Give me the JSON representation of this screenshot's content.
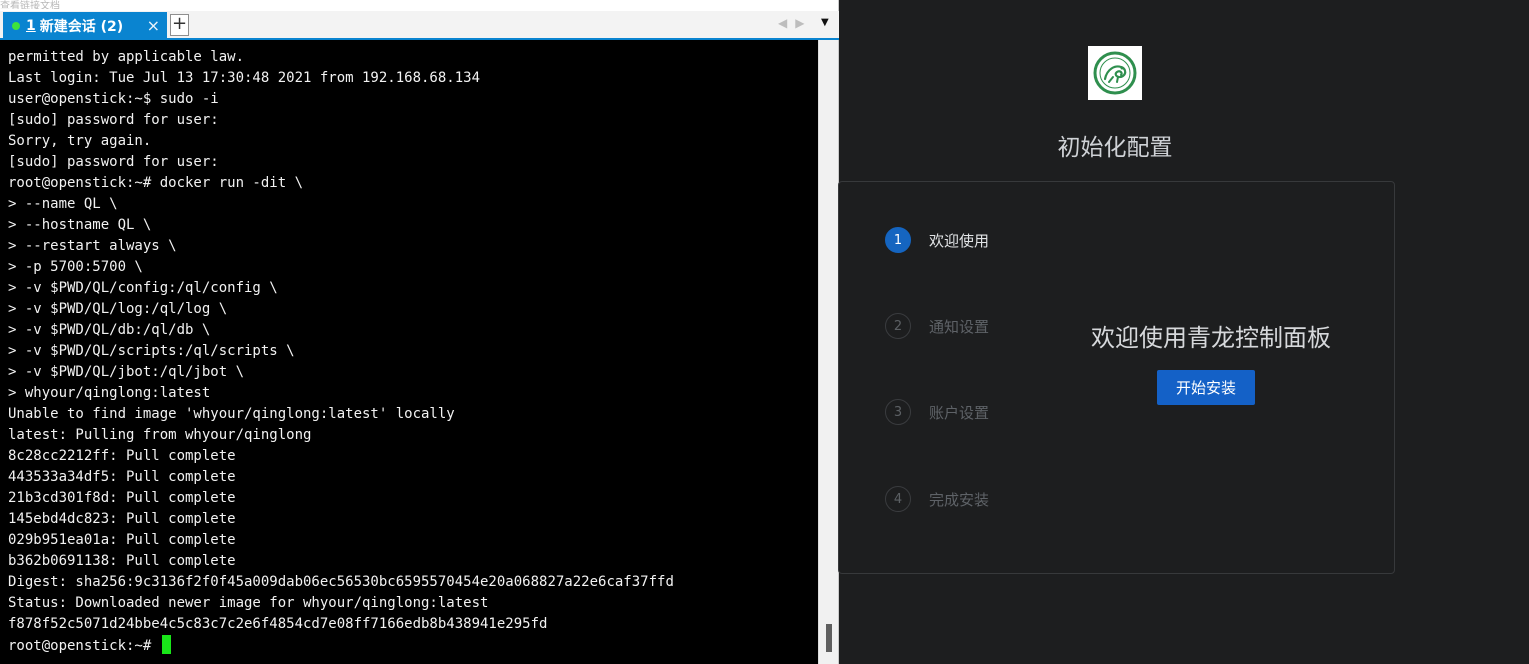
{
  "window": {
    "breadcrumb_fragment": "查看链接文档"
  },
  "terminal_tabs": {
    "active_tab": {
      "number": "1",
      "title": "新建会话 (2)",
      "close_glyph": "×"
    },
    "add_glyph": "+",
    "nav_glyphs": "◀▶",
    "menu_glyph": "▼"
  },
  "terminal": {
    "lines": [
      "permitted by applicable law.",
      "Last login: Tue Jul 13 17:30:48 2021 from 192.168.68.134",
      "user@openstick:~$ sudo -i",
      "[sudo] password for user:",
      "Sorry, try again.",
      "[sudo] password for user:",
      "root@openstick:~# docker run -dit \\",
      "> --name QL \\",
      "> --hostname QL \\",
      "> --restart always \\",
      "> -p 5700:5700 \\",
      "> -v $PWD/QL/config:/ql/config \\",
      "> -v $PWD/QL/log:/ql/log \\",
      "> -v $PWD/QL/db:/ql/db \\",
      "> -v $PWD/QL/scripts:/ql/scripts \\",
      "> -v $PWD/QL/jbot:/ql/jbot \\",
      "> whyour/qinglong:latest",
      "Unable to find image 'whyour/qinglong:latest' locally",
      "latest: Pulling from whyour/qinglong",
      "8c28cc2212ff: Pull complete",
      "443533a34df5: Pull complete",
      "21b3cd301f8d: Pull complete",
      "145ebd4dc823: Pull complete",
      "029b951ea01a: Pull complete",
      "b362b0691138: Pull complete",
      "Digest: sha256:9c3136f2f0f45a009dab06ec56530bc6595570454e20a068827a22e6caf37ffd",
      "Status: Downloaded newer image for whyour/qinglong:latest",
      "f878f52c5071d24bbe4c5c83c7c2e6f4854cd7e08ff7166edb8b438941e295fd"
    ],
    "prompt": "root@openstick:~# ",
    "cursor_color": "#19e619"
  },
  "setup": {
    "logo_icon": "qinglong-dragon-logo-icon",
    "title": "初始化配置",
    "steps": [
      {
        "number": "1",
        "label": "欢迎使用",
        "active": true
      },
      {
        "number": "2",
        "label": "通知设置",
        "active": false
      },
      {
        "number": "3",
        "label": "账户设置",
        "active": false
      },
      {
        "number": "4",
        "label": "完成安装",
        "active": false
      }
    ],
    "welcome_heading": "欢迎使用青龙控制面板",
    "start_button": "开始安装",
    "colors": {
      "accent": "#1461c7",
      "background": "#1d1e1f"
    }
  }
}
